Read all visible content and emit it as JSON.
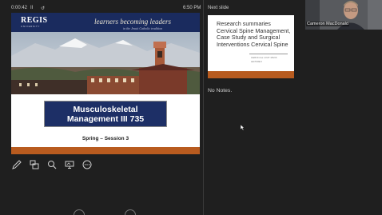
{
  "presenter": {
    "timer": "0:00:42",
    "clock": "6:50 PM",
    "pause_glyph": "II",
    "reset_glyph": "↺"
  },
  "current_slide": {
    "logo": "REGIS",
    "logo_sub": "UNIVERSITY",
    "tagline": "learners becoming leaders",
    "tagline_sub": "in the Jesuit Catholic tradition",
    "title_line1": "Musculoskeletal",
    "title_line2": "Management III 735",
    "session": "Spring – Session 3"
  },
  "next_slide": {
    "label": "Next slide",
    "title": "Research summaries Cervical Spine Management, Case Study and Surgical Interventions Cervical Spine",
    "subtitle": "CERVICAL UNIT MMIII",
    "lecture": "LECTURE 6"
  },
  "notes": {
    "text": "No Notes."
  },
  "participant": {
    "name": "Cameron MacDonald"
  },
  "tools": [
    "pen-icon",
    "slides-grid-icon",
    "zoom-icon",
    "screen-icon",
    "more-icon"
  ],
  "colors": {
    "background": "#1f1f1f",
    "navy": "#1d2f66",
    "footer_orange": "#b85b1f"
  }
}
